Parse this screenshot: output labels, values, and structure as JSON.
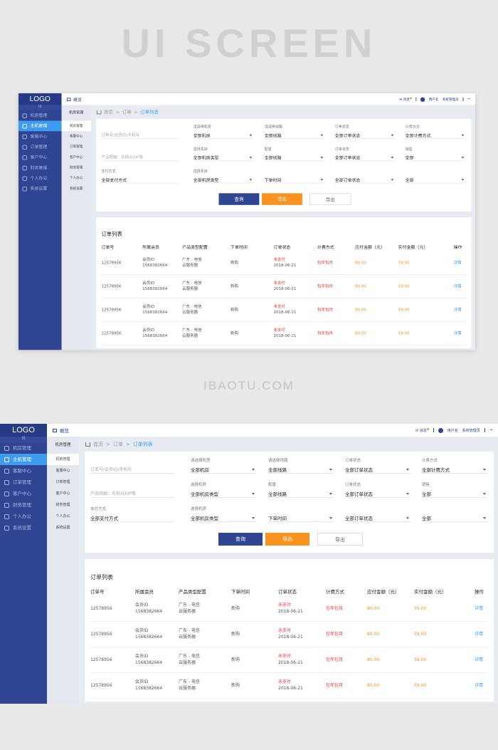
{
  "hero_title": "UI SCREEN",
  "site": "IBAOTU.COM",
  "logo": "LOGO",
  "logo_bars": "III",
  "sidebar": [
    "机房管理",
    "主机管理",
    "客服中心",
    "订单管理",
    "客户中心",
    "财务管理",
    "个人办公",
    "系统设置"
  ],
  "sidebar_active": 1,
  "subnav": {
    "header": "机房管理",
    "items": [
      "机房管理",
      "客服中心",
      "订单管理",
      "客户中心",
      "财务管理",
      "个人办公",
      "系统设置"
    ]
  },
  "topbar": {
    "overview": "概览",
    "messages": "消息",
    "user": "用户名",
    "role": "系统管理员"
  },
  "breadcrumb": [
    "首页",
    ">",
    "订单",
    ">",
    "订单列表"
  ],
  "filters": [
    [
      {
        "label": "",
        "value": "订单号/会员ID/手机号",
        "placeholder": true
      },
      {
        "label": "",
        "value": "产品明细：名称/ID/IP等",
        "placeholder": true
      },
      {
        "label": "支付方式",
        "value": "全部支付方式"
      }
    ],
    [
      {
        "label": "请选择机房",
        "value": "全部机房",
        "select": true
      },
      {
        "label": "选择机房",
        "value": "全部机房类型",
        "select": true
      },
      {
        "label": "选择机房",
        "value": "全部机房类型",
        "select": true
      }
    ],
    [
      {
        "label": "请选择线路",
        "value": "全部线路",
        "select": true
      },
      {
        "label": "配置",
        "value": "全部线路",
        "select": true
      },
      {
        "label": "",
        "value": "下单时间",
        "select": true
      }
    ],
    [
      {
        "label": "订单状态",
        "value": "全部订单状态",
        "select": true
      },
      {
        "label": "订单状态",
        "value": "全部订单状态",
        "select": true
      },
      {
        "label": "",
        "value": "全部订单状态",
        "select": true
      }
    ],
    [
      {
        "label": "计费方式",
        "value": "全部计费方式",
        "select": true
      },
      {
        "label": "销售",
        "value": "全部",
        "select": true
      },
      {
        "label": "",
        "value": "全部",
        "select": true
      }
    ]
  ],
  "buttons": {
    "query": "查询",
    "export": "导出",
    "export2": "导出"
  },
  "colors": {
    "sidebar": "#2f4592",
    "active": "#3d9cf0",
    "orange": "#f7931e",
    "red": "#ff3333"
  },
  "table": {
    "title": "订单列表",
    "headers": [
      "订单号",
      "所属会员",
      "产品类型配置",
      "下单时间",
      "订单状态",
      "计费方式",
      "应付金额（元）",
      "实付金额（元）",
      "操作"
    ],
    "rows": [
      {
        "id": "12578956",
        "member1": "会员ID",
        "member2": "1568382664",
        "prod1": "广东 - 电信",
        "prod2": "云服务器",
        "type": "新购",
        "status": "未支付",
        "date": "2018-06-21",
        "billing": "包年包月",
        "due": "80.00",
        "paid": "59.00",
        "action": "详情"
      },
      {
        "id": "12578956",
        "member1": "会员ID",
        "member2": "1568382664",
        "prod1": "广东 - 电信",
        "prod2": "云服务器",
        "type": "新购",
        "status": "未支付",
        "date": "2018-06-21",
        "billing": "包年包月",
        "due": "80.00",
        "paid": "59.00",
        "action": "详情"
      },
      {
        "id": "12578956",
        "member1": "会员ID",
        "member2": "1568382664",
        "prod1": "广东 - 电信",
        "prod2": "云服务器",
        "type": "新购",
        "status": "未支付",
        "date": "2018-06-21",
        "billing": "包年包月",
        "due": "80.00",
        "paid": "59.00",
        "action": "详情"
      },
      {
        "id": "12578956",
        "member1": "会员ID",
        "member2": "1568382664",
        "prod1": "广东 - 电信",
        "prod2": "云服务器",
        "type": "新购",
        "status": "未支付",
        "date": "2018-06-21",
        "billing": "包年包月",
        "due": "80.00",
        "paid": "59.00",
        "action": "详情"
      }
    ]
  }
}
